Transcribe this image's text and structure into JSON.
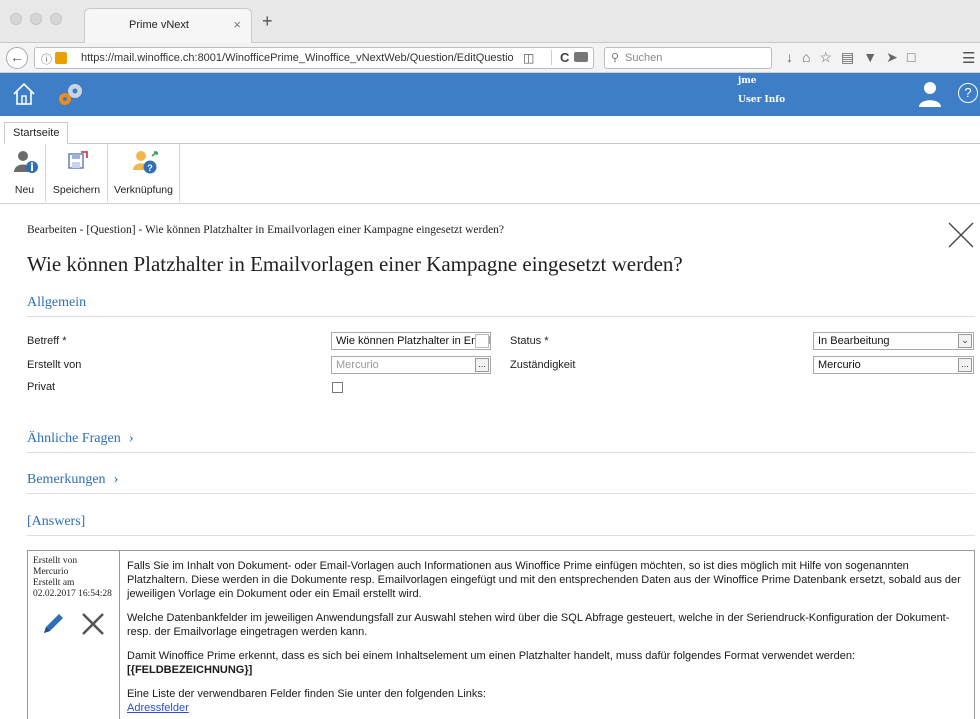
{
  "browser": {
    "tab_title": "Prime vNext",
    "tab_close": "×",
    "new_tab": "+",
    "url": "https://mail.winoffice.ch:8001/WinofficePrime_Winoffice_vNextWeb/Question/EditQuestio",
    "search_placeholder": "Suchen"
  },
  "header": {
    "user_name": "jme",
    "user_info": "User Info",
    "help": "?",
    "colors": {
      "bar": "#3d7ec6",
      "accent": "#e8a000"
    }
  },
  "ribbon": {
    "tab_label": "Startseite",
    "buttons": [
      {
        "label": "Neu",
        "icon": "new-user-icon"
      },
      {
        "label": "Speichern",
        "icon": "save-icon"
      },
      {
        "label": "Verknüpfung",
        "icon": "link-users-icon"
      }
    ]
  },
  "page": {
    "breadcrumb": "Bearbeiten - [Question] - Wie können Platzhalter in Emailvorlagen einer Kampagne eingesetzt werden?",
    "title": "Wie können Platzhalter in Emailvorlagen einer Kampagne eingesetzt werden?"
  },
  "sections": {
    "general": "Allgemein",
    "similar": "Ähnliche Fragen",
    "remarks": "Bemerkungen",
    "answers": "[Answers]"
  },
  "form": {
    "subject_label": "Betreff *",
    "subject_value": "Wie können Platzhalter in Emailvorla",
    "created_by_label": "Erstellt von",
    "created_by_value": "Mercurio",
    "private_label": "Privat",
    "status_label": "Status *",
    "status_value": "In Bearbeitung",
    "responsible_label": "Zuständigkeit",
    "responsible_value": "Mercurio",
    "browse": "..."
  },
  "answer": {
    "created_by_label": "Erstellt von",
    "created_by": "Mercurio",
    "created_at_label": "Erstellt am",
    "created_at": "02.02.2017 16:54:28",
    "p1": "Falls Sie im Inhalt von Dokument- oder Email-Vorlagen auch Informationen aus Winoffice Prime einfügen möchten, so ist dies möglich mit Hilfe von sogenannten Platzhaltern. Diese werden in die Dokumente resp. Emailvorlagen eingefügt und mit den entsprechenden Daten aus der Winoffice Prime Datenbank ersetzt, sobald aus der jeweiligen Vorlage ein Dokument oder ein Email erstellt wird.",
    "p2": "Welche Datenbankfelder im jeweiligen Anwendungsfall zur Auswahl stehen wird über die SQL Abfrage gesteuert, welche in der Seriendruck-Konfiguration der Dokument- resp. der Emailvorlage eingetragen werden kann.",
    "p3": "Damit Winoffice Prime erkennt, dass es sich bei einem Inhaltselement um einen Platzhalter handelt, muss dafür folgendes Format verwendet werden:",
    "p3_format": "[{FELDBEZEICHNUNG}]",
    "p4": "Eine Liste der verwendbaren Felder finden Sie unter den folgenden Links:",
    "link1": "Adressfelder"
  }
}
